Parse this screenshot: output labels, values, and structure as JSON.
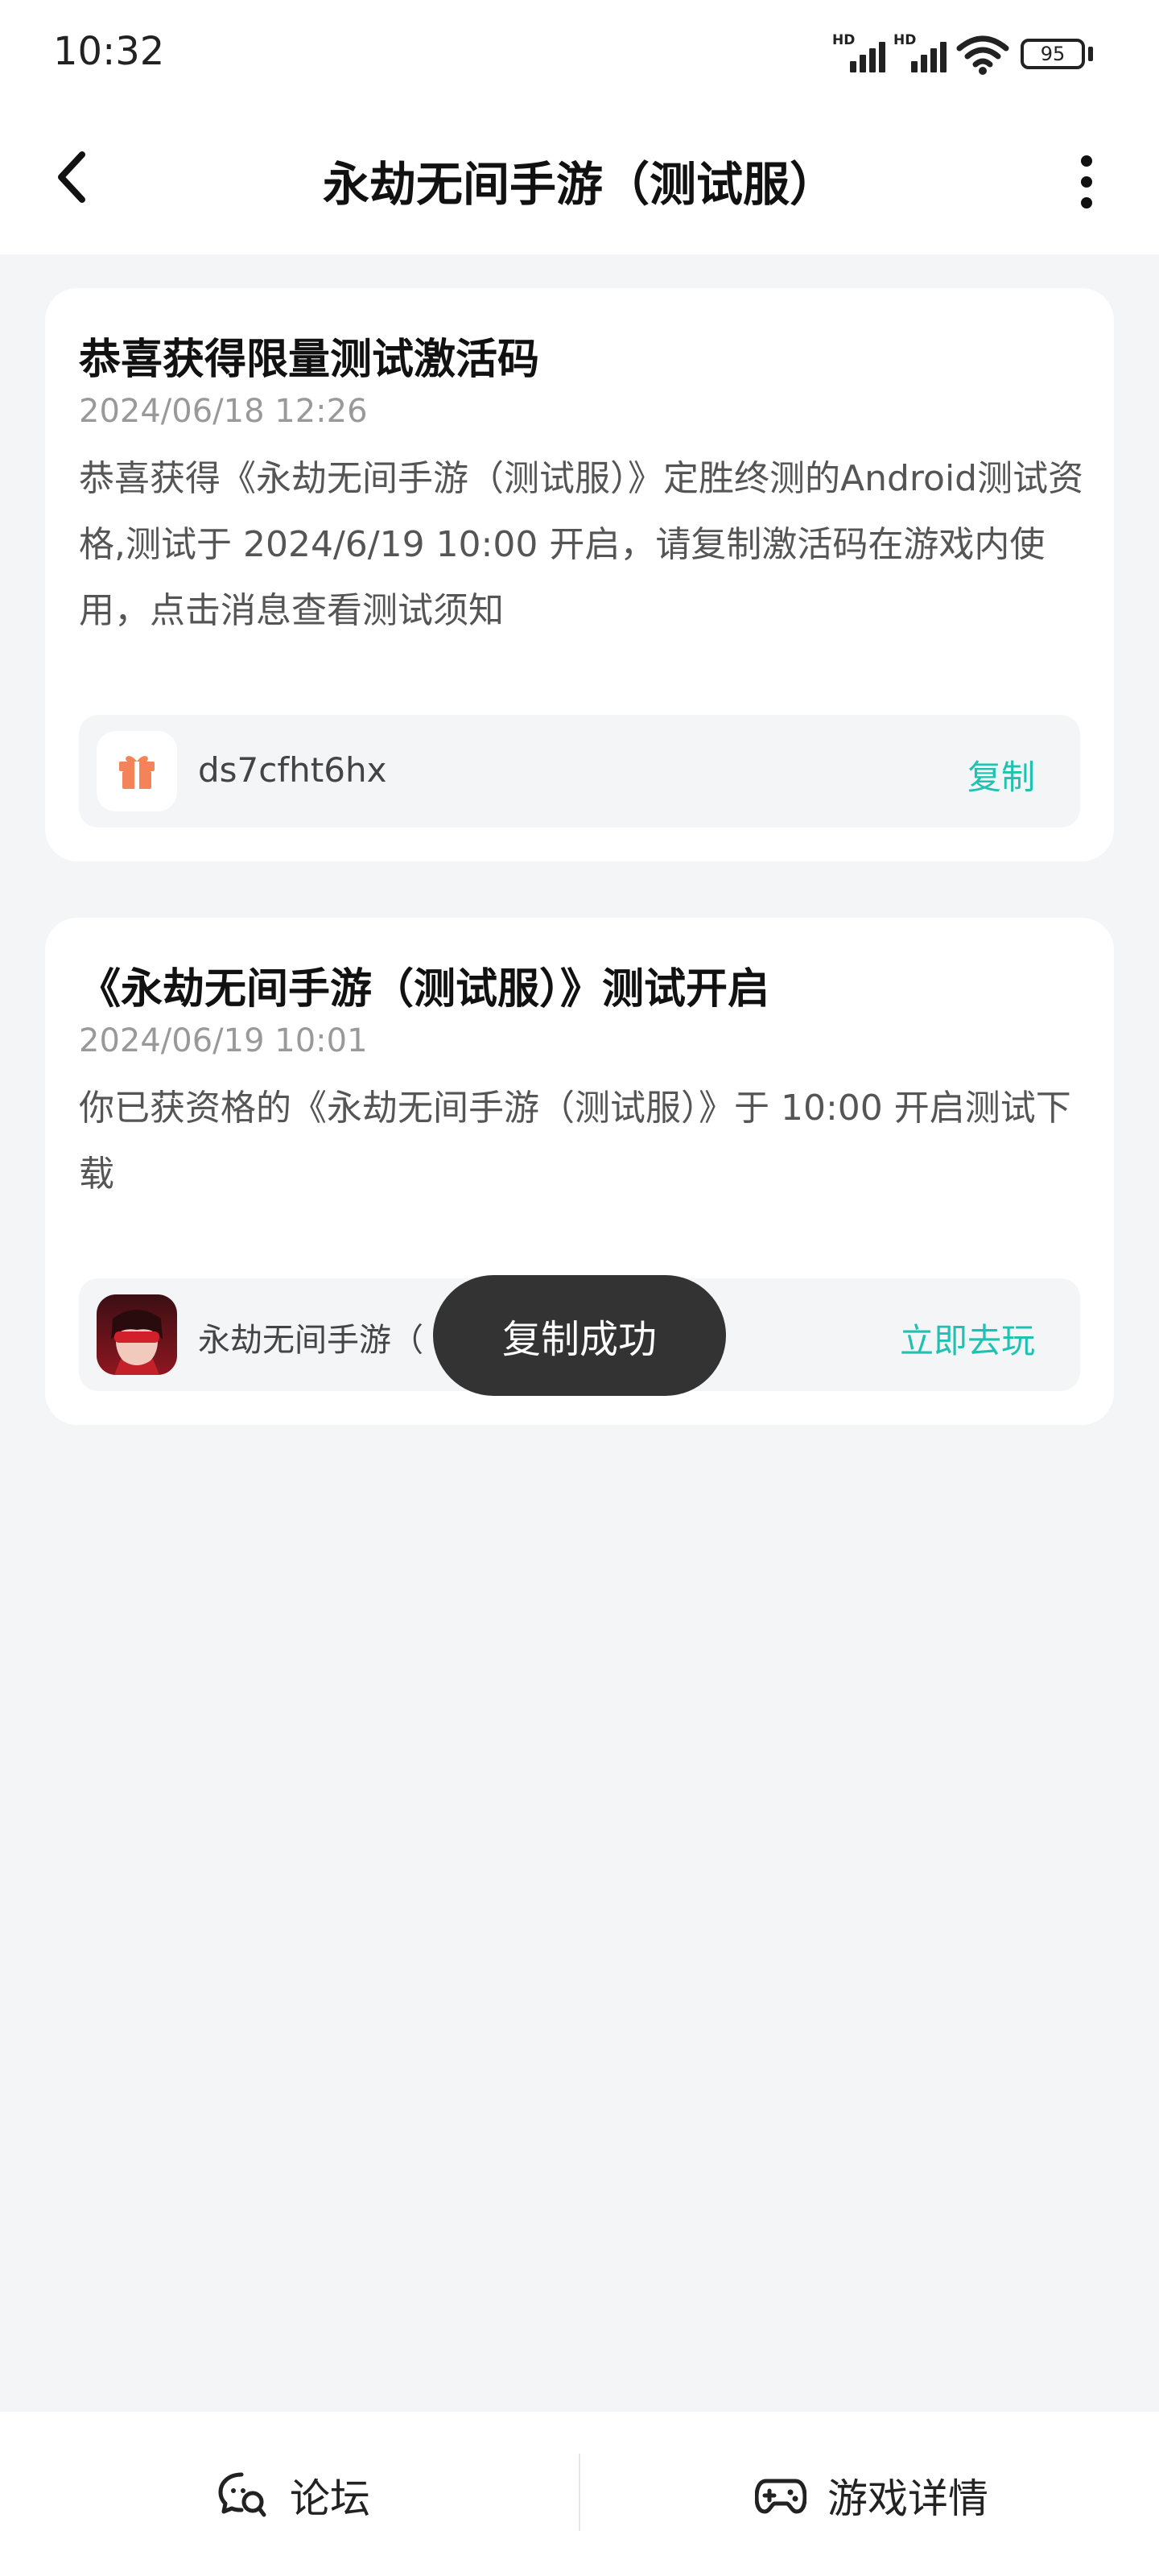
{
  "status_bar": {
    "time": "10:32",
    "signal1_label": "HD",
    "signal2_label": "HD",
    "battery": "95"
  },
  "nav": {
    "title": "永劫无间手游（测试服）"
  },
  "cards": [
    {
      "title": "恭喜获得限量测试激活码",
      "date": "2024/06/18 12:26",
      "body": "恭喜获得《永劫无间手游（测试服）》定胜终测的Android测试资格,测试于 2024/6/19 10:00 开启，请复制激活码在游戏内使用，点击消息查看测试须知",
      "code": "ds7cfht6hx",
      "action": "复制",
      "icon": "gift-icon"
    },
    {
      "title": "《永劫无间手游（测试服）》测试开启",
      "date": "2024/06/19 10:01",
      "body": "你已获资格的《永劫无间手游（测试服）》于 10:00 开启测试下载",
      "game_name": "永劫无间手游（",
      "action": "立即去玩",
      "icon": "game-icon"
    }
  ],
  "toast": "复制成功",
  "bottom_bar": {
    "forum": "论坛",
    "game_detail": "游戏详情"
  },
  "colors": {
    "accent": "#1fc2b0",
    "gift": "#f5835a",
    "background": "#f4f5f7"
  }
}
